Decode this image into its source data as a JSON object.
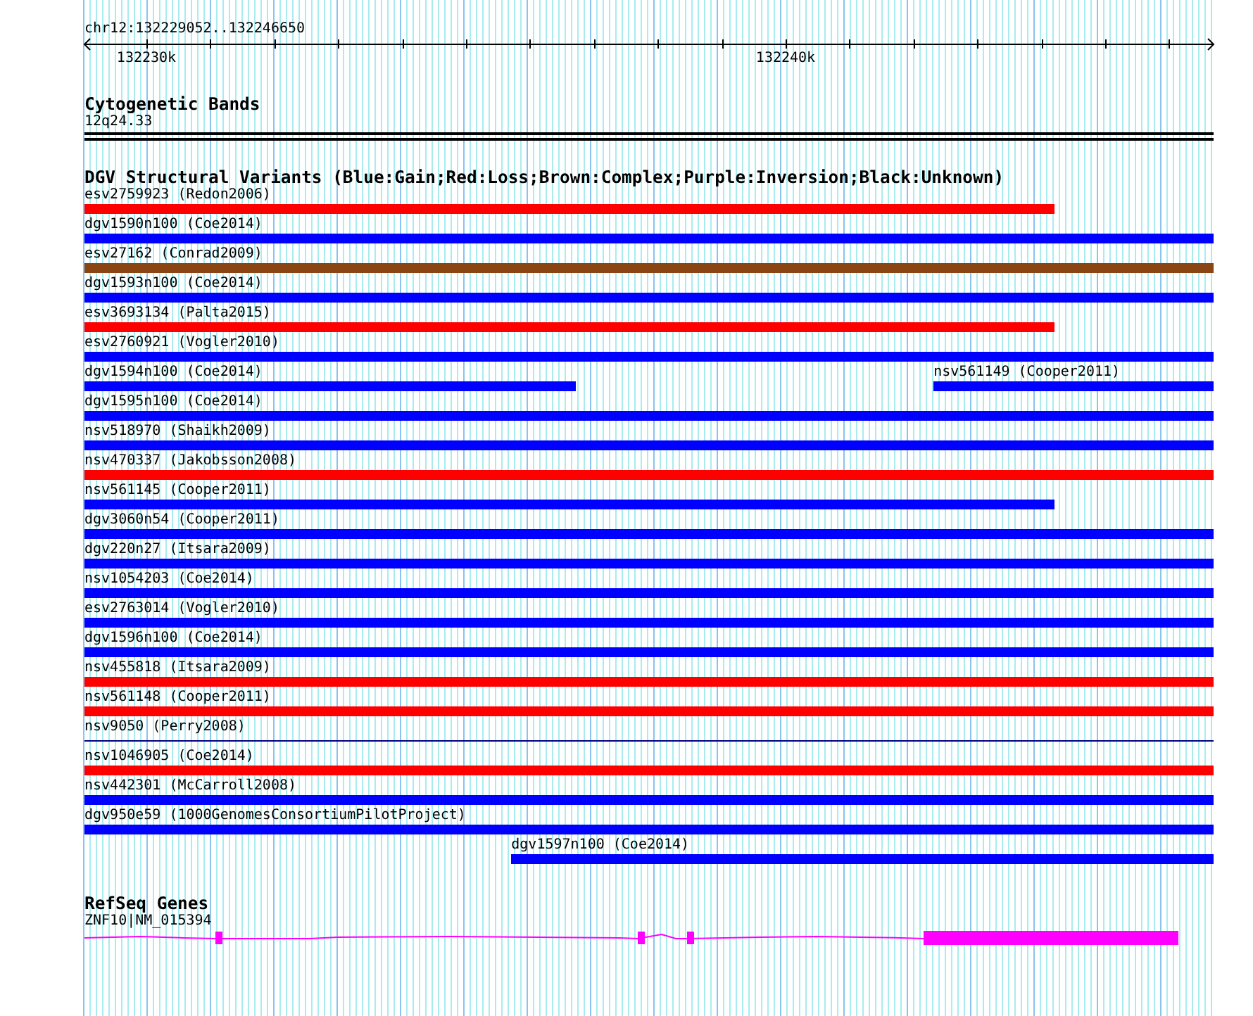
{
  "ruler": {
    "region": "chr12:132229052..132246650",
    "ticks": [
      "132230k",
      "132240k"
    ]
  },
  "tracks": [
    {
      "kind": "bands",
      "title": "Cytogenetic Bands",
      "band": "12q24.33"
    },
    {
      "kind": "variants",
      "title": "DGV Structural Variants (Blue:Gain;Red:Loss;Brown:Complex;Purple:Inversion;Black:Unknown)",
      "lanes": [
        {
          "features": [
            {
              "label": "esv2759923 (Redon2006)",
              "kind": "bar",
              "color": "#ff0000"
            }
          ]
        },
        {
          "features": [
            {
              "label": "dgv1590n100 (Coe2014)",
              "kind": "bar",
              "color": "#0000ff"
            }
          ]
        },
        {
          "features": [
            {
              "label": "esv27162 (Conrad2009)",
              "kind": "bar",
              "color": "#8b4513"
            }
          ]
        },
        {
          "features": [
            {
              "label": "dgv1593n100 (Coe2014)",
              "kind": "bar",
              "color": "#0000ff"
            }
          ]
        },
        {
          "features": [
            {
              "label": "esv3693134 (Palta2015)",
              "kind": "bar",
              "color": "#ff0000"
            }
          ]
        },
        {
          "features": [
            {
              "label": "esv2760921 (Vogler2010)",
              "kind": "bar",
              "color": "#0000ff"
            }
          ]
        },
        {
          "features": [
            {
              "label": "dgv1594n100 (Coe2014)",
              "kind": "bar",
              "color": "#0000ff"
            },
            {
              "label": "nsv561149 (Cooper2011)",
              "kind": "bar",
              "color": "#0000ff"
            }
          ]
        },
        {
          "features": [
            {
              "label": "dgv1595n100 (Coe2014)",
              "kind": "bar",
              "color": "#0000ff"
            }
          ]
        },
        {
          "features": [
            {
              "label": "nsv518970 (Shaikh2009)",
              "kind": "bar",
              "color": "#0000ff"
            }
          ]
        },
        {
          "features": [
            {
              "label": "nsv470337 (Jakobsson2008)",
              "kind": "bar",
              "color": "#ff0000"
            }
          ]
        },
        {
          "features": [
            {
              "label": "nsv561145 (Cooper2011)",
              "kind": "bar",
              "color": "#0000ff"
            }
          ]
        },
        {
          "features": [
            {
              "label": "dgv3060n54 (Cooper2011)",
              "kind": "bar",
              "color": "#0000ff"
            }
          ]
        },
        {
          "features": [
            {
              "label": "dgv220n27 (Itsara2009)",
              "kind": "bar",
              "color": "#0000ff"
            }
          ]
        },
        {
          "features": [
            {
              "label": "nsv1054203 (Coe2014)",
              "kind": "bar",
              "color": "#0000ff"
            }
          ]
        },
        {
          "features": [
            {
              "label": "esv2763014 (Vogler2010)",
              "kind": "bar",
              "color": "#0000ff"
            }
          ]
        },
        {
          "features": [
            {
              "label": "dgv1596n100 (Coe2014)",
              "kind": "bar",
              "color": "#0000ff"
            }
          ]
        },
        {
          "features": [
            {
              "label": "nsv455818 (Itsara2009)",
              "kind": "bar",
              "color": "#ff0000"
            }
          ]
        },
        {
          "features": [
            {
              "label": "nsv561148 (Cooper2011)",
              "kind": "bar",
              "color": "#ff0000"
            }
          ]
        },
        {
          "features": [
            {
              "label": "nsv9050 (Perry2008)",
              "kind": "line",
              "color": "#000080"
            }
          ]
        },
        {
          "features": [
            {
              "label": "nsv1046905 (Coe2014)",
              "kind": "bar",
              "color": "#ff0000"
            }
          ]
        },
        {
          "features": [
            {
              "label": "nsv442301 (McCarroll2008)",
              "kind": "bar",
              "color": "#0000ff"
            }
          ]
        },
        {
          "features": [
            {
              "label": "dgv950e59 (1000GenomesConsortiumPilotProject)",
              "kind": "bar",
              "color": "#0000ff"
            }
          ]
        },
        {
          "features": [
            {
              "label": "dgv1597n100 (Coe2014)",
              "kind": "bar",
              "color": "#0000ff"
            }
          ]
        }
      ]
    },
    {
      "kind": "genes",
      "title": "RefSeq Genes",
      "genes": [
        {
          "label": "ZNF10|NM_015394"
        }
      ]
    }
  ]
}
